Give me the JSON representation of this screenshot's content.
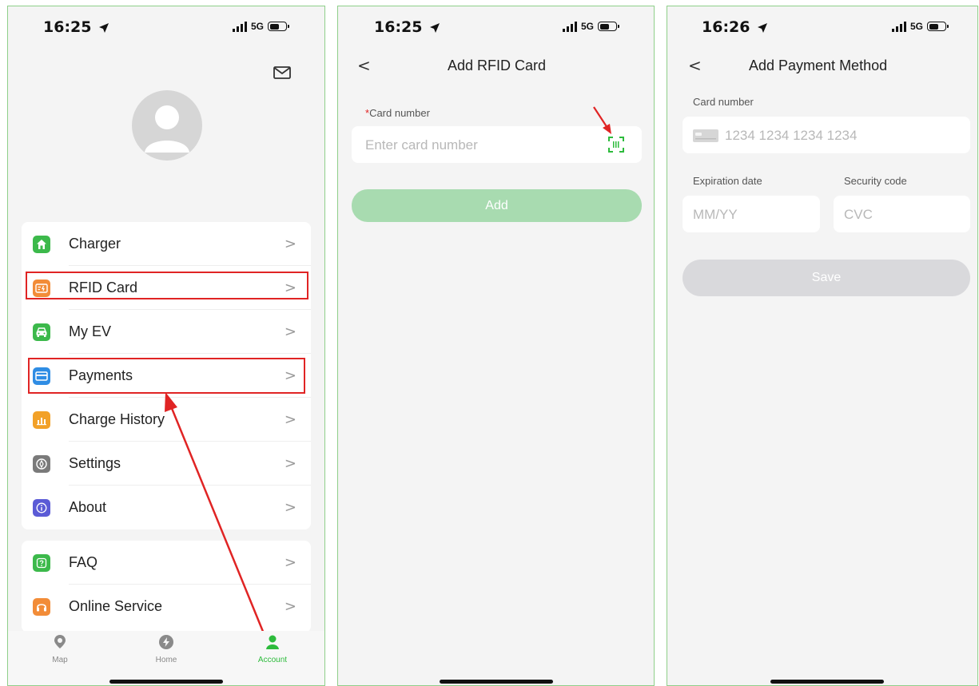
{
  "screens": {
    "account": {
      "status": {
        "time": "16:25",
        "network": "5G"
      },
      "menu_main": [
        {
          "label": "Charger",
          "icon": "home-icon",
          "color": "#3cb94b"
        },
        {
          "label": "RFID Card",
          "icon": "rfid-card-icon",
          "color": "#f28c38"
        },
        {
          "label": "My EV",
          "icon": "car-icon",
          "color": "#3cb94b"
        },
        {
          "label": "Payments",
          "icon": "credit-card-icon",
          "color": "#2f8de4"
        },
        {
          "label": "Charge History",
          "icon": "bar-chart-icon",
          "color": "#f2a128"
        },
        {
          "label": "Settings",
          "icon": "gear-icon",
          "color": "#7a7a7a"
        },
        {
          "label": "About",
          "icon": "info-icon",
          "color": "#5b5bd6"
        }
      ],
      "menu_support": [
        {
          "label": "FAQ",
          "icon": "question-icon",
          "color": "#3cb94b"
        },
        {
          "label": "Online Service",
          "icon": "headset-icon",
          "color": "#f28c38"
        }
      ],
      "chevron": ">",
      "tabs": [
        {
          "label": "Map",
          "icon": "map-pin-icon"
        },
        {
          "label": "Home",
          "icon": "lightning-icon"
        },
        {
          "label": "Account",
          "icon": "person-icon"
        }
      ],
      "active_tab": "Account",
      "accent_color": "#2dbb3c",
      "highlight_color": "#e02424"
    },
    "add_rfid": {
      "status": {
        "time": "16:25",
        "network": "5G"
      },
      "back": "<",
      "title": "Add RFID Card",
      "field_required_mark": "*",
      "field_label": "Card number",
      "field_placeholder": "Enter card number",
      "add_button": "Add",
      "button_color": "#a8dbb0"
    },
    "add_payment": {
      "status": {
        "time": "16:26",
        "network": "5G"
      },
      "back": "<",
      "title": "Add Payment Method",
      "card_number_label": "Card number",
      "card_number_placeholder": "1234 1234 1234 1234",
      "expiration_label": "Expiration date",
      "expiration_placeholder": "MM/YY",
      "security_label": "Security code",
      "security_placeholder": "CVC",
      "save_button": "Save",
      "button_color": "#d9d9dc"
    }
  }
}
